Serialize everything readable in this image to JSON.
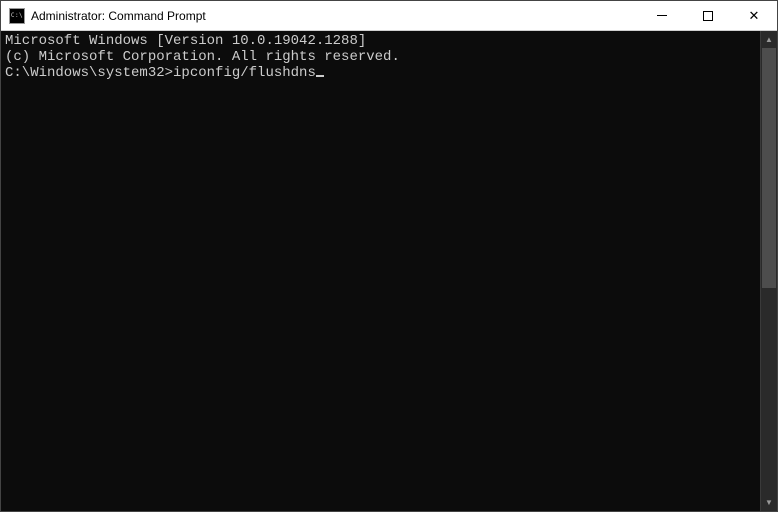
{
  "window": {
    "title": "Administrator: Command Prompt"
  },
  "terminal": {
    "line1": "Microsoft Windows [Version 10.0.19042.1288]",
    "line2": "(c) Microsoft Corporation. All rights reserved.",
    "blank": "",
    "prompt": "C:\\Windows\\system32>",
    "command": "ipconfig/flushdns"
  }
}
